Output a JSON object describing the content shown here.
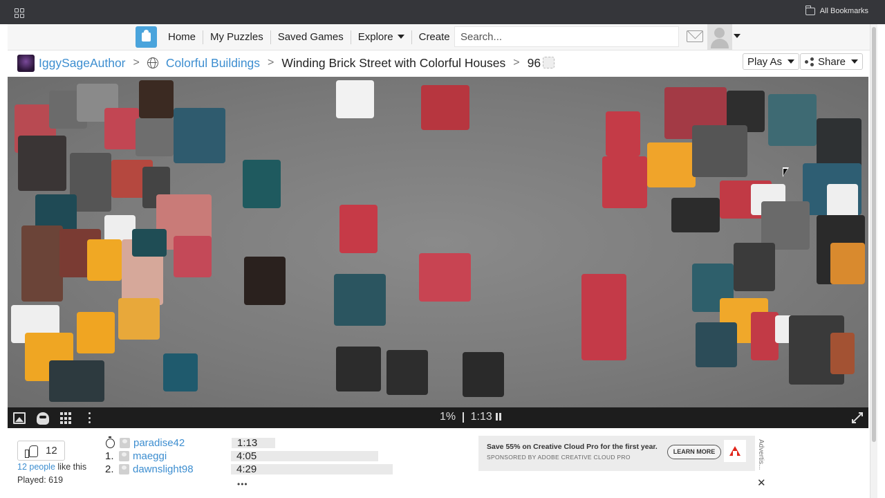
{
  "browser": {
    "all_bookmarks": "All Bookmarks"
  },
  "nav": {
    "links": [
      "Home",
      "My Puzzles",
      "Saved Games",
      "Explore",
      "Create"
    ],
    "search_placeholder": "Search..."
  },
  "breadcrumb": {
    "author": "IggySageAuthor",
    "category": "Colorful Buildings",
    "title": "Winding Brick Street with Colorful Houses",
    "piece_count": "96",
    "play_as": "Play As",
    "share": "Share"
  },
  "toolbar": {
    "progress": "1%",
    "timer": "1:13"
  },
  "likes": {
    "count": "12",
    "people_link": "12 people",
    "like_text": " like this",
    "played": "Played: 619"
  },
  "scores": [
    {
      "rank": "",
      "player": "paradise42",
      "time": "1:13"
    },
    {
      "rank": "1.",
      "player": "maeggi",
      "time": "4:05"
    },
    {
      "rank": "2.",
      "player": "dawnslight98",
      "time": "4:29"
    }
  ],
  "scores_more": "•••",
  "ad": {
    "title": "Save 55% on Creative Cloud Pro for the first year.",
    "sponsor": "SPONSORED BY ADOBE CREATIVE CLOUD PRO",
    "cta": "LEARN MORE",
    "label": "Advertis...",
    "close": "✕"
  },
  "colors": {
    "link": "#3d8ed0",
    "board": "#7a7a7a",
    "toolbar": "#1d1d1d"
  }
}
